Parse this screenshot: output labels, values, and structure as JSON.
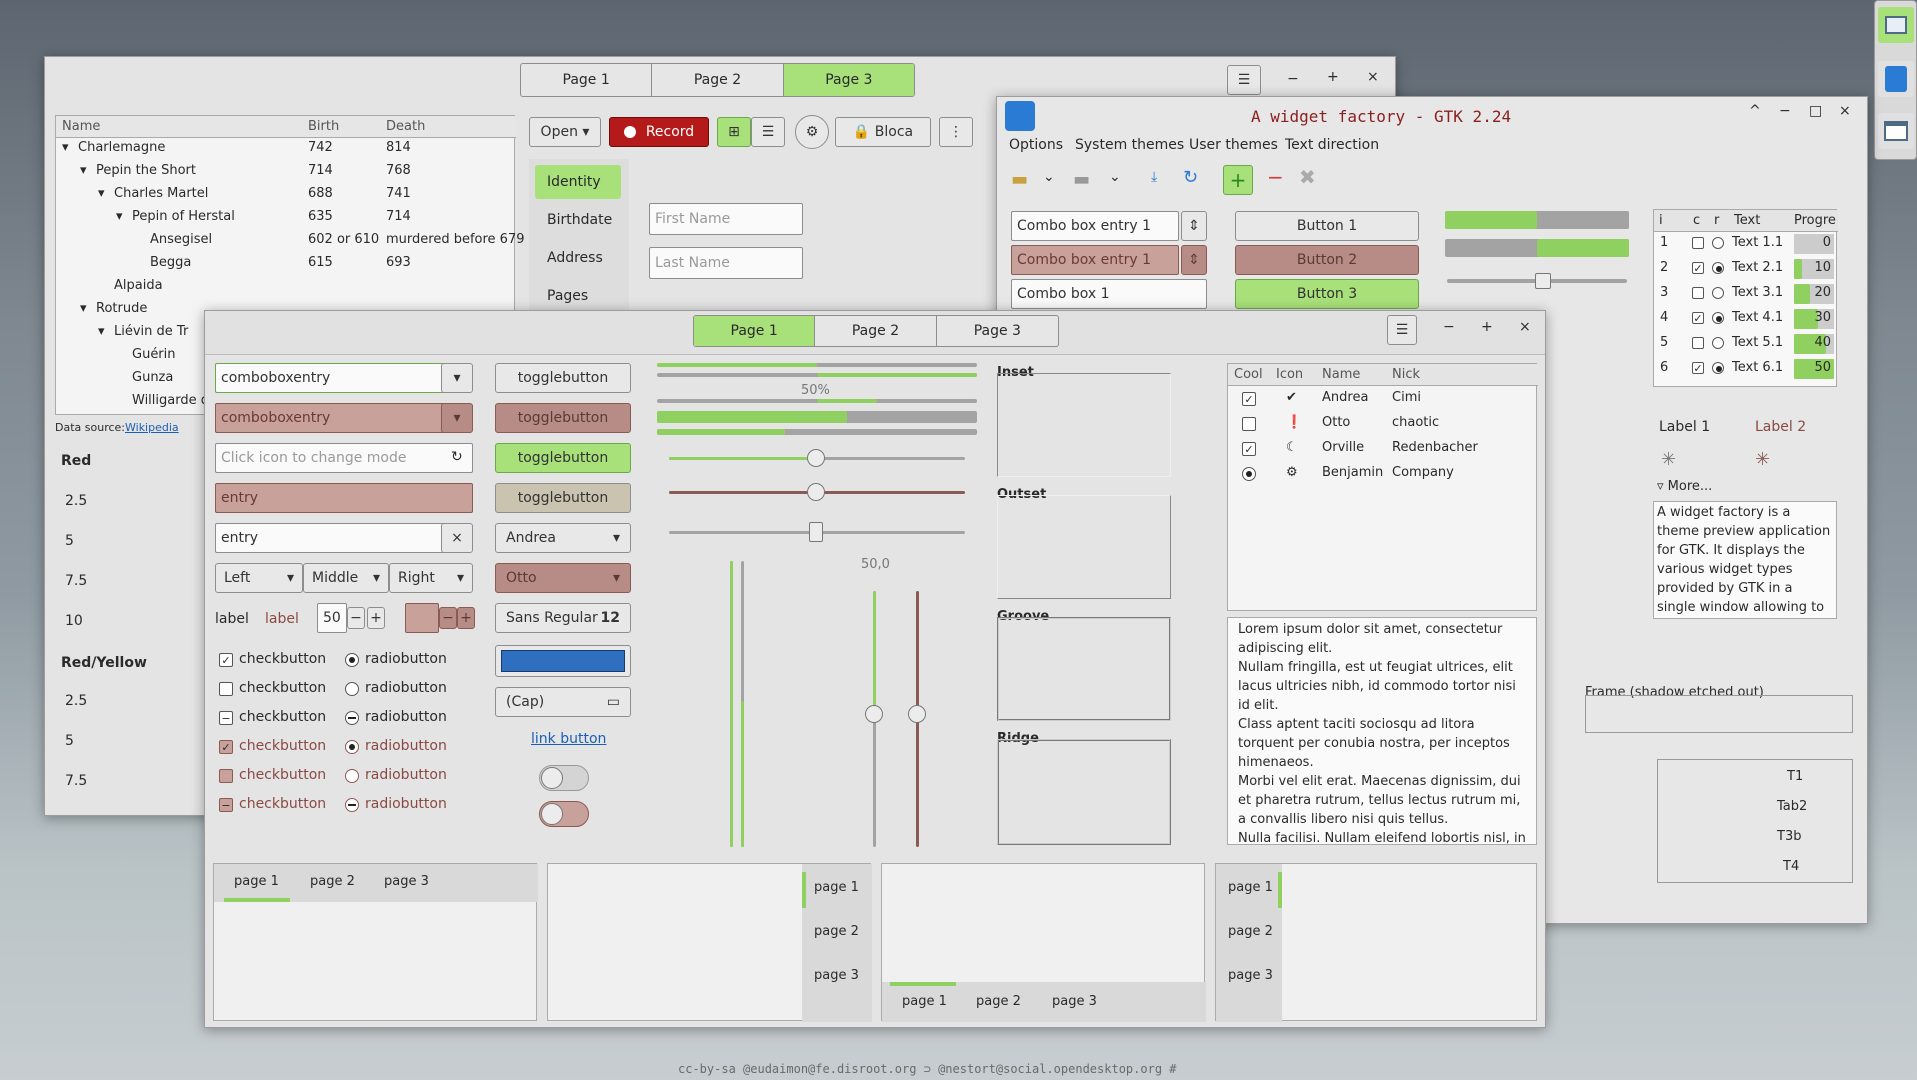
{
  "colors": {
    "accent": "#a8e07a",
    "accent_dark": "#6aa84a",
    "record": "#b51a1a",
    "swatch": "#2e6fbf",
    "error": "#c9a19b"
  },
  "footer": "cc-by-sa @eudaimon@fe.disroot.org ⊃ @nestort@social.opendesktop.org #",
  "sidebar_icons": [
    "panel-icon",
    "gtk-app-icon",
    "window-icon"
  ],
  "back_window": {
    "tabs": [
      "Page 1",
      "Page 2",
      "Page 3"
    ],
    "tree": {
      "headers": [
        "Name",
        "Birth",
        "Death"
      ],
      "rows": [
        [
          "Charlemagne",
          "742",
          "814"
        ],
        [
          "Pepin the Short",
          "714",
          "768"
        ],
        [
          "Charles Martel",
          "688",
          "741"
        ],
        [
          "Pepin of Herstal",
          "635",
          "714"
        ],
        [
          "Ansegisel",
          "602 or 610",
          "murdered before 679"
        ],
        [
          "Begga",
          "615",
          "693"
        ],
        [
          "Alpaida",
          "",
          ""
        ],
        [
          "Rotrude",
          "",
          ""
        ],
        [
          "Liévin de Tr",
          "",
          ""
        ],
        [
          "Guérin",
          "",
          ""
        ],
        [
          "Gunza",
          "",
          ""
        ],
        [
          "Willigarde de",
          "",
          ""
        ]
      ]
    },
    "data_source_label": "Data source:",
    "data_source_link": "Wikipedia",
    "toolbar": {
      "open": "Open",
      "record": "Record",
      "lock": "Bloca"
    },
    "side_tabs": [
      "Identity",
      "Birthdate",
      "Address",
      "Pages"
    ],
    "first_name": "First Name",
    "last_name": "Last Name",
    "list_red": {
      "title": "Red",
      "values": [
        "2.5",
        "5",
        "7.5",
        "10"
      ]
    },
    "list_ry": {
      "title": "Red/Yellow",
      "values": [
        "2.5",
        "5",
        "7.5"
      ]
    }
  },
  "gtk_window": {
    "title": "A widget factory - GTK 2.24",
    "menu": [
      "Options",
      "System themes",
      "User themes",
      "Text direction"
    ],
    "combos": [
      "Combo box entry 1",
      "Combo box entry 1",
      "Combo box 1"
    ],
    "buttons": [
      "Button 1",
      "Button 2",
      "Button 3"
    ],
    "list": {
      "headers": [
        "i",
        "c",
        "r",
        "Text",
        "Progre"
      ],
      "rows": [
        {
          "i": "1",
          "c": false,
          "r": false,
          "text": "Text 1.1",
          "p": "0"
        },
        {
          "i": "2",
          "c": true,
          "r": true,
          "text": "Text 2.1",
          "p": "10"
        },
        {
          "i": "3",
          "c": false,
          "r": false,
          "text": "Text 3.1",
          "p": "20"
        },
        {
          "i": "4",
          "c": true,
          "r": true,
          "text": "Text 4.1",
          "p": "30"
        },
        {
          "i": "5",
          "c": false,
          "r": false,
          "text": "Text 5.1",
          "p": "40"
        },
        {
          "i": "6",
          "c": true,
          "r": true,
          "text": "Text 6.1",
          "p": "50"
        }
      ]
    },
    "label1": "Label 1",
    "label2": "Label 2",
    "more": "More...",
    "textview": "A widget factory is a theme preview application for GTK. It displays the various widget types provided by GTK in a single window allowing to see the visual",
    "frame_label": "Frame (shadow etched out)",
    "vtabs": [
      "T1",
      "Tab2",
      "T3b",
      "T4"
    ]
  },
  "front_window": {
    "tabs": [
      "Page 1",
      "Page 2",
      "Page 3"
    ],
    "col1": {
      "combo1": "comboboxentry",
      "combo2": "comboboxentry",
      "entry_ph": "Click icon to change mode",
      "entry_err": "entry",
      "entry_clear": "entry",
      "align": [
        "Left",
        "Middle",
        "Right"
      ],
      "label1": "label",
      "label2": "label",
      "spin": "50",
      "check_label": "checkbutton",
      "radio_label": "radiobutton"
    },
    "col2": {
      "toggle": "togglebutton",
      "andrea": "Andrea",
      "otto": "Otto",
      "font": "Sans Regular",
      "font_size": "12",
      "file": "(Cap)",
      "link": "link button"
    },
    "progress_label": "50%",
    "scale_value": "50,0",
    "frames": [
      "Inset",
      "Outset",
      "Groove",
      "Ridge"
    ],
    "tree": {
      "headers": [
        "Cool",
        "Icon",
        "Name",
        "Nick"
      ],
      "rows": [
        {
          "name": "Andrea",
          "nick": "Cimi",
          "cool": true
        },
        {
          "name": "Otto",
          "nick": "chaotic",
          "cool": false
        },
        {
          "name": "Orville",
          "nick": "Redenbacher",
          "cool": true
        },
        {
          "name": "Benjamin",
          "nick": "Company",
          "cool": "radio"
        }
      ]
    },
    "lorem": "Lorem ipsum dolor sit amet, consectetur adipiscing elit.\nNullam fringilla, est ut feugiat ultrices, elit lacus ultricies nibh, id commodo tortor nisi id elit.\nClass aptent taciti sociosqu ad litora torquent per conubia nostra, per inceptos himenaeos.\nMorbi vel elit erat. Maecenas dignissim, dui et pharetra rutrum, tellus lectus rutrum mi, a convallis libero nisi quis tellus.\nNulla facilisi. Nullam eleifend lobortis nisl, in",
    "notebook_tabs": [
      "page 1",
      "page 2",
      "page 3"
    ]
  }
}
